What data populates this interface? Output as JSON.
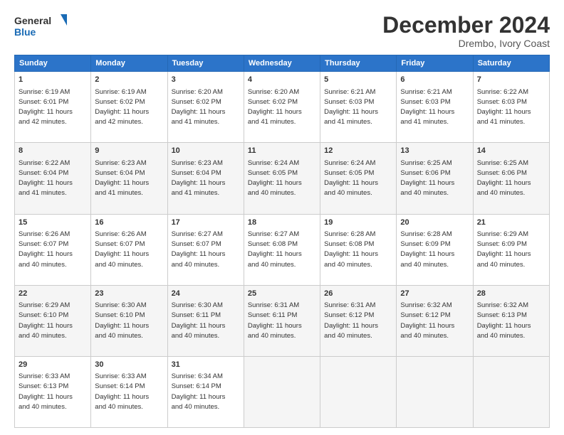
{
  "logo": {
    "line1": "General",
    "line2": "Blue"
  },
  "title": "December 2024",
  "location": "Drembo, Ivory Coast",
  "days_of_week": [
    "Sunday",
    "Monday",
    "Tuesday",
    "Wednesday",
    "Thursday",
    "Friday",
    "Saturday"
  ],
  "weeks": [
    [
      {
        "day": "1",
        "sunrise": "6:19 AM",
        "sunset": "6:01 PM",
        "daylight": "11 hours and 42 minutes."
      },
      {
        "day": "2",
        "sunrise": "6:19 AM",
        "sunset": "6:02 PM",
        "daylight": "11 hours and 42 minutes."
      },
      {
        "day": "3",
        "sunrise": "6:20 AM",
        "sunset": "6:02 PM",
        "daylight": "11 hours and 41 minutes."
      },
      {
        "day": "4",
        "sunrise": "6:20 AM",
        "sunset": "6:02 PM",
        "daylight": "11 hours and 41 minutes."
      },
      {
        "day": "5",
        "sunrise": "6:21 AM",
        "sunset": "6:03 PM",
        "daylight": "11 hours and 41 minutes."
      },
      {
        "day": "6",
        "sunrise": "6:21 AM",
        "sunset": "6:03 PM",
        "daylight": "11 hours and 41 minutes."
      },
      {
        "day": "7",
        "sunrise": "6:22 AM",
        "sunset": "6:03 PM",
        "daylight": "11 hours and 41 minutes."
      }
    ],
    [
      {
        "day": "8",
        "sunrise": "6:22 AM",
        "sunset": "6:04 PM",
        "daylight": "11 hours and 41 minutes."
      },
      {
        "day": "9",
        "sunrise": "6:23 AM",
        "sunset": "6:04 PM",
        "daylight": "11 hours and 41 minutes."
      },
      {
        "day": "10",
        "sunrise": "6:23 AM",
        "sunset": "6:04 PM",
        "daylight": "11 hours and 41 minutes."
      },
      {
        "day": "11",
        "sunrise": "6:24 AM",
        "sunset": "6:05 PM",
        "daylight": "11 hours and 40 minutes."
      },
      {
        "day": "12",
        "sunrise": "6:24 AM",
        "sunset": "6:05 PM",
        "daylight": "11 hours and 40 minutes."
      },
      {
        "day": "13",
        "sunrise": "6:25 AM",
        "sunset": "6:06 PM",
        "daylight": "11 hours and 40 minutes."
      },
      {
        "day": "14",
        "sunrise": "6:25 AM",
        "sunset": "6:06 PM",
        "daylight": "11 hours and 40 minutes."
      }
    ],
    [
      {
        "day": "15",
        "sunrise": "6:26 AM",
        "sunset": "6:07 PM",
        "daylight": "11 hours and 40 minutes."
      },
      {
        "day": "16",
        "sunrise": "6:26 AM",
        "sunset": "6:07 PM",
        "daylight": "11 hours and 40 minutes."
      },
      {
        "day": "17",
        "sunrise": "6:27 AM",
        "sunset": "6:07 PM",
        "daylight": "11 hours and 40 minutes."
      },
      {
        "day": "18",
        "sunrise": "6:27 AM",
        "sunset": "6:08 PM",
        "daylight": "11 hours and 40 minutes."
      },
      {
        "day": "19",
        "sunrise": "6:28 AM",
        "sunset": "6:08 PM",
        "daylight": "11 hours and 40 minutes."
      },
      {
        "day": "20",
        "sunrise": "6:28 AM",
        "sunset": "6:09 PM",
        "daylight": "11 hours and 40 minutes."
      },
      {
        "day": "21",
        "sunrise": "6:29 AM",
        "sunset": "6:09 PM",
        "daylight": "11 hours and 40 minutes."
      }
    ],
    [
      {
        "day": "22",
        "sunrise": "6:29 AM",
        "sunset": "6:10 PM",
        "daylight": "11 hours and 40 minutes."
      },
      {
        "day": "23",
        "sunrise": "6:30 AM",
        "sunset": "6:10 PM",
        "daylight": "11 hours and 40 minutes."
      },
      {
        "day": "24",
        "sunrise": "6:30 AM",
        "sunset": "6:11 PM",
        "daylight": "11 hours and 40 minutes."
      },
      {
        "day": "25",
        "sunrise": "6:31 AM",
        "sunset": "6:11 PM",
        "daylight": "11 hours and 40 minutes."
      },
      {
        "day": "26",
        "sunrise": "6:31 AM",
        "sunset": "6:12 PM",
        "daylight": "11 hours and 40 minutes."
      },
      {
        "day": "27",
        "sunrise": "6:32 AM",
        "sunset": "6:12 PM",
        "daylight": "11 hours and 40 minutes."
      },
      {
        "day": "28",
        "sunrise": "6:32 AM",
        "sunset": "6:13 PM",
        "daylight": "11 hours and 40 minutes."
      }
    ],
    [
      {
        "day": "29",
        "sunrise": "6:33 AM",
        "sunset": "6:13 PM",
        "daylight": "11 hours and 40 minutes."
      },
      {
        "day": "30",
        "sunrise": "6:33 AM",
        "sunset": "6:14 PM",
        "daylight": "11 hours and 40 minutes."
      },
      {
        "day": "31",
        "sunrise": "6:34 AM",
        "sunset": "6:14 PM",
        "daylight": "11 hours and 40 minutes."
      },
      null,
      null,
      null,
      null
    ]
  ]
}
